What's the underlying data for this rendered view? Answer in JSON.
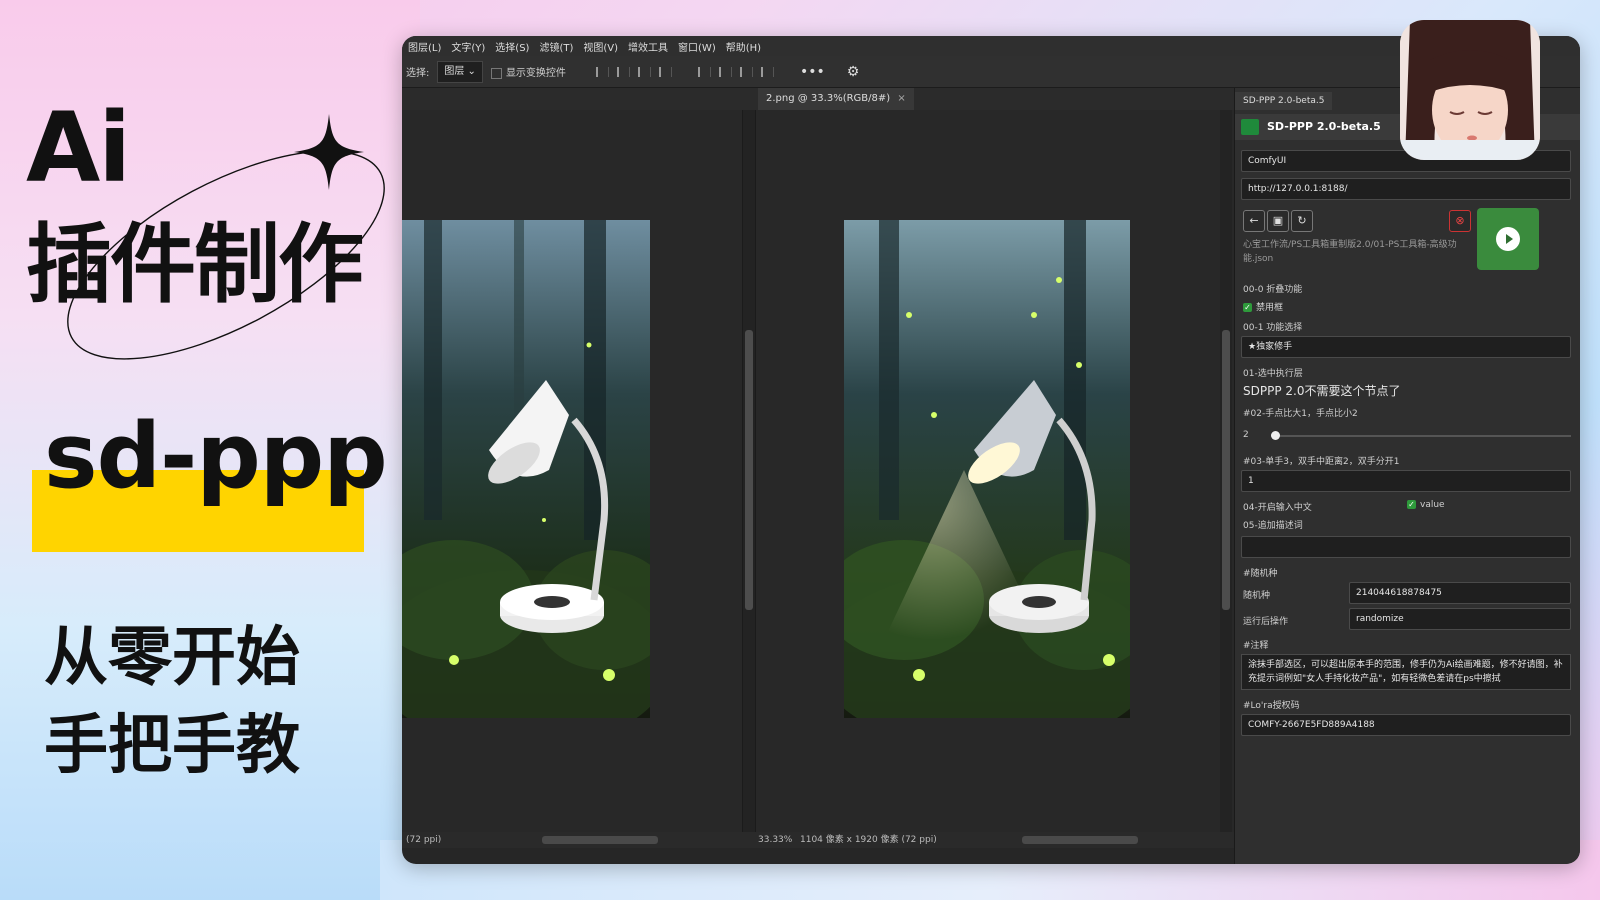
{
  "promo": {
    "title_ai": "Ai",
    "title_cn": "插件制作",
    "brand": "sd-ppp",
    "subtitle_1": "从零开始",
    "subtitle_2": "手把手教"
  },
  "menubar": {
    "items": [
      "图层(L)",
      "文字(Y)",
      "选择(S)",
      "滤镜(T)",
      "视图(V)",
      "增效工具",
      "窗口(W)",
      "帮助(H)"
    ]
  },
  "optionsbar": {
    "select_label": "选择:",
    "select_value": "图层",
    "transform_checkbox_label": "显示变换控件",
    "more_icon": "more-icon",
    "gear_icon": "gear-icon"
  },
  "document": {
    "tab_label": "2.png @ 33.3%(RGB/8#)",
    "close_glyph": "×",
    "status_left": "(72 ppi)",
    "status_zoom": "33.33%",
    "status_info": "1104 像素 x 1920 像素 (72 ppi)"
  },
  "panel": {
    "tab_label": "SD-PPP 2.0-beta.5",
    "title": "SD-PPP 2.0-beta.5",
    "backend": "ComfyUI",
    "url": "http://127.0.0.1:8188/",
    "workflow_path": "心宝工作流/PS工具箱重制版2.0/01-PS工具箱-高级功能.json",
    "fields": {
      "f00_0_label": "00-0 折叠功能",
      "f00_0_check_label": "禁用框",
      "f00_1_label": "00-1 功能选择",
      "f00_1_value": "★独家修手",
      "f01_label": "01-选中执行层",
      "f01_text": "SDPPP 2.0不需要这个节点了",
      "f02_label": "#02-手点比大1，手点比小2",
      "f02_value": "2",
      "f03_label": "#03-单手3，双手中距离2，双手分开1",
      "f03_value": "1",
      "f04_label": "04-开启输入中文",
      "f04_check_label": "value",
      "f05_label": "05-追加描述词",
      "seed_section": "#随机种",
      "seed_label": "随机种",
      "seed_value": "214044618878475",
      "after_run_label": "运行后操作",
      "after_run_value": "randomize",
      "note_section": "#注释",
      "note_text": "涂抹手部选区，可以超出原本手的范围，修手仍为Ai绘画难题，修不好请图，补充提示词例如\"女人手持化妆产品\"，如有轻微色差请在ps中擦拭",
      "lora_section": "#Lo'ra授权码",
      "lora_value": "COMFY-2667E5FD889A4188"
    }
  },
  "colors": {
    "accent_yellow": "#ffd400",
    "run_green": "#3a8b3d",
    "ps_bg": "#262626"
  }
}
